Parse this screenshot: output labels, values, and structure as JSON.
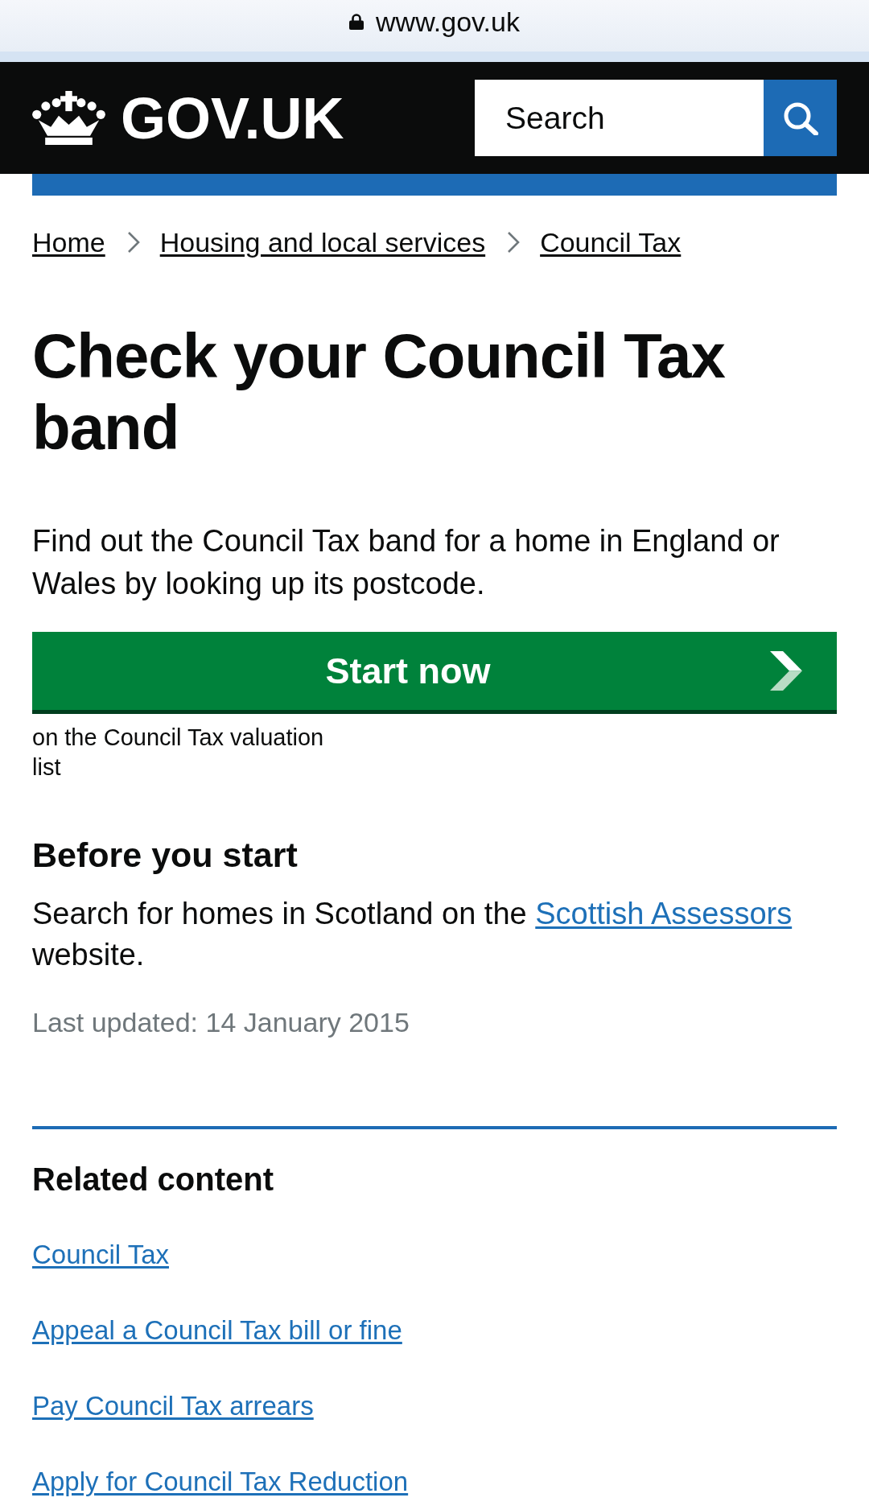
{
  "browser": {
    "url": "www.gov.uk"
  },
  "header": {
    "logo": "GOV.UK",
    "search": {
      "placeholder": "Search"
    }
  },
  "breadcrumbs": [
    {
      "label": "Home"
    },
    {
      "label": "Housing and local services"
    },
    {
      "label": "Council Tax"
    }
  ],
  "title": "Check your Council Tax band",
  "lead": "Find out the Council Tax band for a home in England or Wales by looking up its postcode.",
  "start_button": {
    "label": "Start now"
  },
  "start_note": "on the Council Tax valuation list",
  "before_you_start": {
    "heading": "Before you start",
    "text": "Search for homes in Scotland on the",
    "link": "Scottish Assessors",
    "text_after": "website."
  },
  "last_updated": "Last updated: 14 January 2015",
  "related_content": {
    "heading": "Related content",
    "links": [
      "Council Tax",
      "Appeal a Council Tax bill or fine",
      "Pay Council Tax arrears",
      "Apply for Council Tax Reduction"
    ]
  }
}
